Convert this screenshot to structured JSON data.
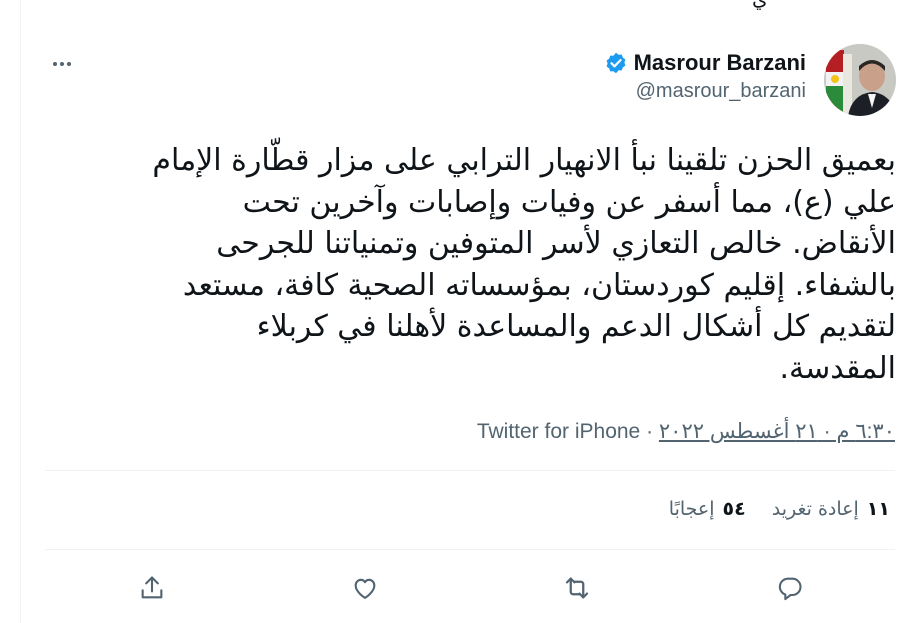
{
  "prev_fragment": "ي",
  "author": {
    "display_name": "Masrour Barzani",
    "handle": "@masrour_barzani"
  },
  "tweet": {
    "text_lines": [
      "بعميق الحزن تلقينا نبأ الانهيار الترابي على مزار قطّارة الإمام",
      "علي (ع)، مما أسفر عن وفيات وإصابات وآخرين تحت",
      "الأنقاض. خالص التعازي لأسر المتوفين وتمنياتنا للجرحى",
      "بالشفاء. إقليم كوردستان، بمؤسساته الصحية كافة، مستعد",
      "لتقديم كل أشكال الدعم والمساعدة لأهلنا في كربلاء",
      "المقدسة."
    ],
    "timestamp": "٦:٣٠ م · ٢١ أغسطس ٢٠٢٢",
    "separator": " · ",
    "source": "Twitter for iPhone"
  },
  "stats": {
    "retweets_count": "١١",
    "retweets_label": "إعادة تغريد",
    "likes_count": "٥٤",
    "likes_label": "إعجابًا"
  },
  "icons": {
    "verified": "verified-badge-icon",
    "more": "more-dots-icon",
    "reply": "reply-icon",
    "retweet": "retweet-icon",
    "like": "heart-icon",
    "share": "share-icon"
  },
  "colors": {
    "verified_blue": "#1d9bf0",
    "muted_text": "#536471",
    "divider": "#eff3f4"
  }
}
